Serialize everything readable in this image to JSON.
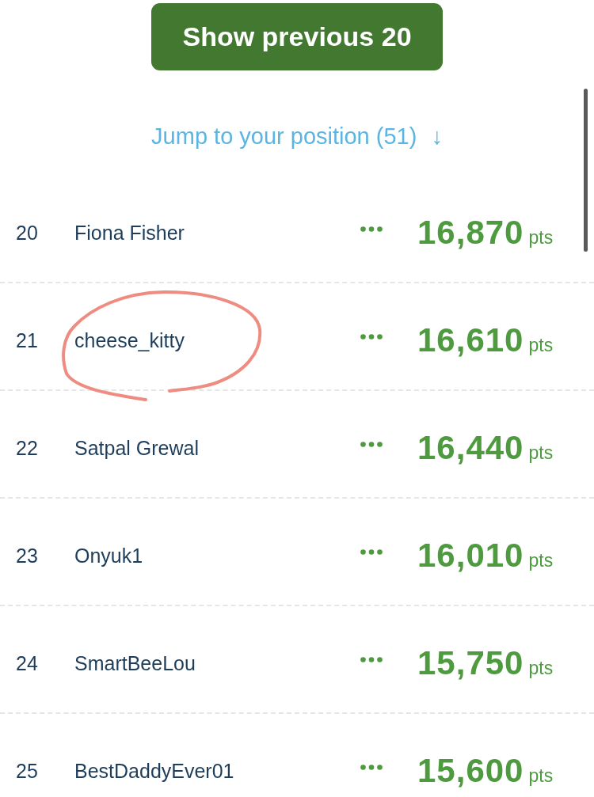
{
  "show_previous_button": {
    "label": "Show previous 20"
  },
  "jump_link": {
    "label": "Jump to your position (51)",
    "arrow": "↓"
  },
  "rows": [
    {
      "rank": "20",
      "name": "Fiona Fisher",
      "points": "16,870",
      "unit": "pts",
      "circled": false
    },
    {
      "rank": "21",
      "name": "cheese_kitty",
      "points": "16,610",
      "unit": "pts",
      "circled": true
    },
    {
      "rank": "22",
      "name": "Satpal Grewal",
      "points": "16,440",
      "unit": "pts",
      "circled": false
    },
    {
      "rank": "23",
      "name": "Onyuk1",
      "points": "16,010",
      "unit": "pts",
      "circled": false
    },
    {
      "rank": "24",
      "name": "SmartBeeLou",
      "points": "15,750",
      "unit": "pts",
      "circled": false
    },
    {
      "rank": "25",
      "name": "BestDaddyEver01",
      "points": "15,600",
      "unit": "pts",
      "circled": false
    }
  ]
}
